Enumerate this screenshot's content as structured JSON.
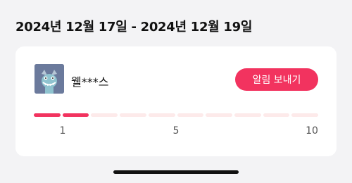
{
  "header": {
    "date_range": "2024년 12월 17일 - 2024년 12월 19일"
  },
  "card": {
    "user": {
      "name": "웰***스",
      "avatar_icon": "monster-avatar-icon"
    },
    "notify_button_label": "알림 보내기",
    "progress": {
      "current": 2,
      "total": 10,
      "ticks": [
        "1",
        "5",
        "10"
      ]
    }
  },
  "colors": {
    "accent": "#f2335f",
    "track": "#fdeaea",
    "background": "#f3f3f5"
  }
}
